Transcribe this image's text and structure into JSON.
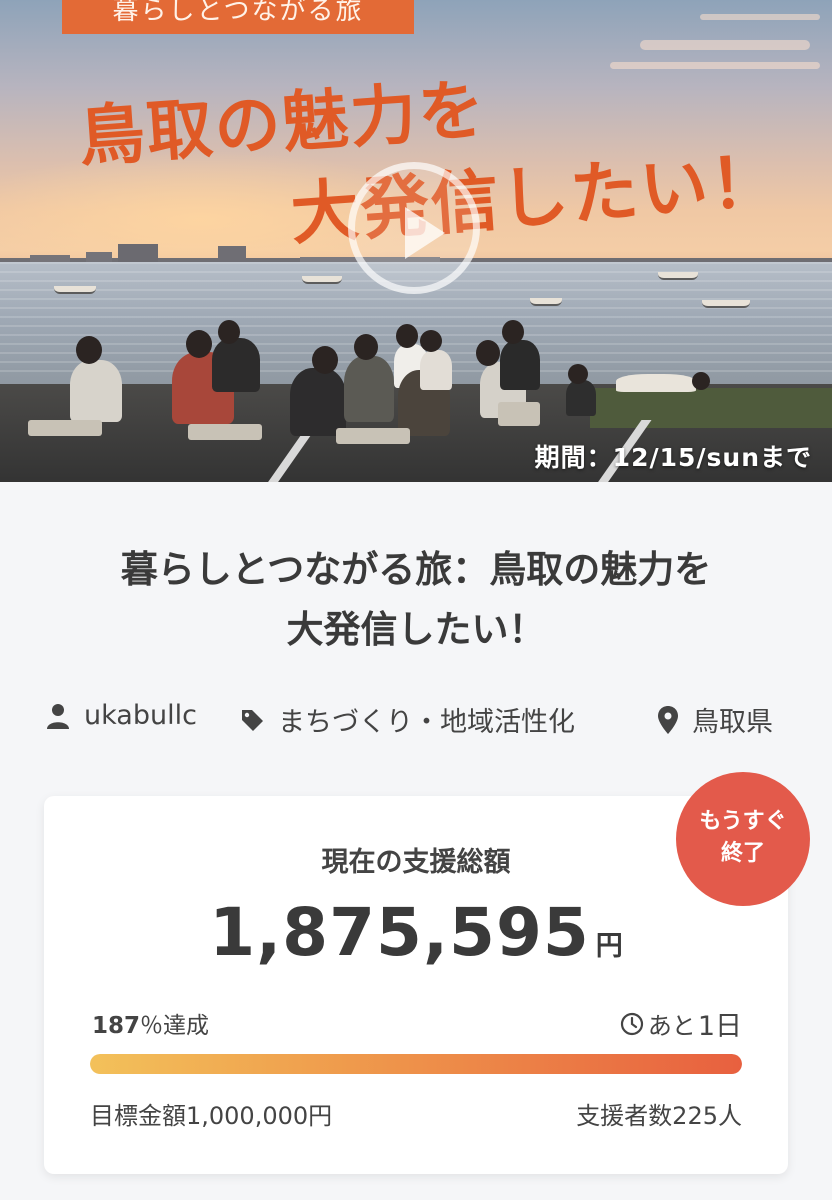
{
  "hero": {
    "tag": "暮らしとつながる旅",
    "title_line1": "鳥取の魅力を",
    "title_line2": "大発信したい！",
    "deadline": "期間：12/15/sunまで"
  },
  "project": {
    "title_line1": "暮らしとつながる旅：鳥取の魅力を",
    "title_line2": "大発信したい！",
    "owner": "ukabullc",
    "category": "まちづくり・地域活性化",
    "location": "鳥取県"
  },
  "funding": {
    "label": "現在の支援総額",
    "amount": "1,875,595",
    "currency": "円",
    "percent": "187",
    "percent_suffix": "％達成",
    "percent_value": 1.87,
    "remaining_prefix": "あと",
    "remaining_days": "1日",
    "goal": "目標金額1,000,000円",
    "backers": "支援者数225人",
    "ending_badge_line1": "もうすぐ",
    "ending_badge_line2": "終了"
  },
  "icons": {
    "owner": "user-icon",
    "category": "tag-icon",
    "location": "map-pin-icon",
    "time": "clock-icon",
    "play": "play-icon"
  },
  "colors": {
    "accent": "#e05a26",
    "badge": "#e35a4b",
    "bar_start": "#f3c15a",
    "bar_end": "#e8603f"
  }
}
